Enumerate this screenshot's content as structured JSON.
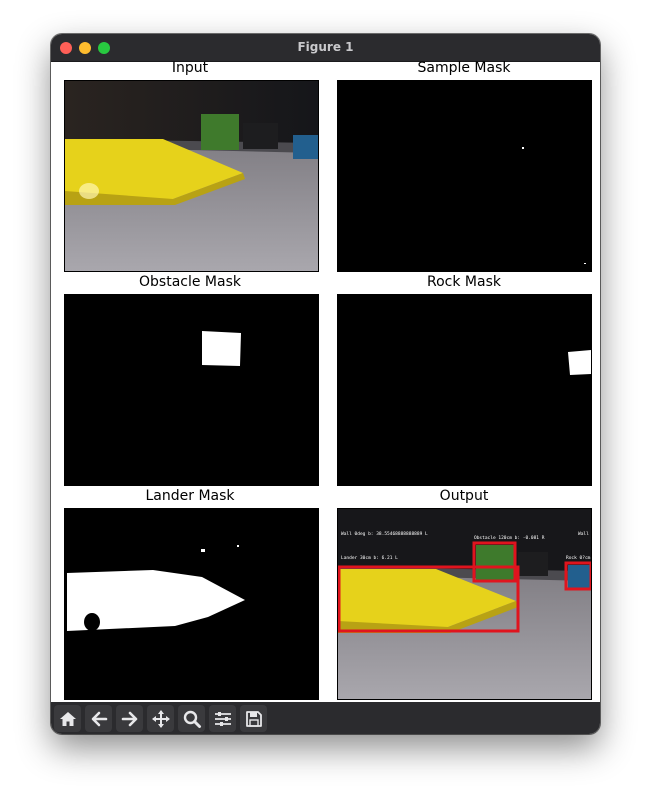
{
  "window": {
    "title": "Figure 1"
  },
  "panels": {
    "input": {
      "title": "Input"
    },
    "sample_mask": {
      "title": "Sample Mask"
    },
    "obstacle_mask": {
      "title": "Obstacle Mask"
    },
    "rock_mask": {
      "title": "Rock Mask"
    },
    "lander_mask": {
      "title": "Lander Mask"
    },
    "output": {
      "title": "Output",
      "annotations": {
        "top_left": "Wall 0deg b: 38.55468888888889 L",
        "lander": "Lander 30cm b: 6.21 L",
        "obstacle": "Obstacle 120cm b: -0.081 R",
        "rock": "Rock 0?cm",
        "wall_right": "Wall"
      }
    }
  },
  "toolbar": {
    "tools": [
      "home-icon",
      "back-arrow-icon",
      "forward-arrow-icon",
      "pan-icon",
      "zoom-icon",
      "configure-subplots-icon",
      "save-icon"
    ]
  },
  "colors": {
    "lander_yellow": "#e8d21c",
    "box_red": "#e0141e",
    "obstacle_green": "#3e7a2c",
    "rock_blue": "#1f5e8c"
  }
}
